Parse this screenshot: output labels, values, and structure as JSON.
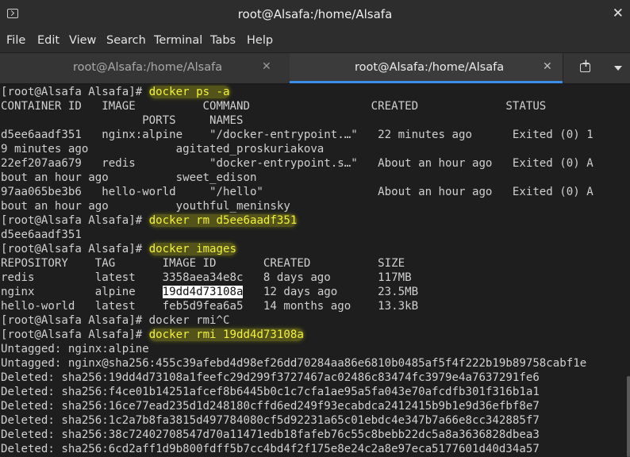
{
  "window": {
    "title": "root@Alsafa:/home/Alsafa",
    "close_glyph": "✕"
  },
  "menu": [
    "File",
    "Edit",
    "View",
    "Search",
    "Terminal",
    "Tabs",
    "Help"
  ],
  "tabs": [
    {
      "label": "root@Alsafa:/home/Alsafa",
      "active": false
    },
    {
      "label": "root@Alsafa:/home/Alsafa",
      "active": true
    }
  ],
  "tab_close_glyph": "✕",
  "icons": {
    "window": "terminal-icon",
    "new_tab": "new-tab-icon",
    "menu": "chevron-down-icon"
  },
  "colors": {
    "highlight": "#f2f23a",
    "tab_accent": "#3a8ee6",
    "terminal_bg": "#1e1e1e"
  },
  "lines": [
    {
      "prompt": "[root@Alsafa Alsafa]# ",
      "cmd": "docker ps -a"
    },
    {
      "text": "CONTAINER ID   IMAGE          COMMAND                  CREATED             STATUS"
    },
    {
      "text": "                     PORTS     NAMES"
    },
    {
      "text": "d5ee6aadf351   nginx:alpine    \"/docker-entrypoint.…\"   22 minutes ago      Exited (0) 1"
    },
    {
      "text": "9 minutes ago             agitated_proskuriakova"
    },
    {
      "text": "22ef207aa679   redis           \"docker-entrypoint.s…\"   About an hour ago   Exited (0) A"
    },
    {
      "text": "bout an hour ago          sweet_edison"
    },
    {
      "text": "97aa065be3b6   hello-world     \"/hello\"                 About an hour ago   Exited (0) A"
    },
    {
      "text": "bout an hour ago          youthful_meninsky"
    },
    {
      "prompt": "[root@Alsafa Alsafa]# ",
      "cmd": "docker rm d5ee6aadf351"
    },
    {
      "text": "d5ee6aadf351"
    },
    {
      "prompt": "[root@Alsafa Alsafa]# ",
      "cmd": "docker images"
    },
    {
      "text": "REPOSITORY    TAG       IMAGE ID       CREATED          SIZE"
    },
    {
      "text": "redis         latest    3358aea34e8c   8 days ago       117MB"
    },
    {
      "before": "nginx         alpine    ",
      "selected": "19dd4d73108a",
      "after": "   12 days ago      23.5MB"
    },
    {
      "text": "hello-world   latest    feb5d9fea6a5   14 months ago    13.3kB"
    },
    {
      "text": "[root@Alsafa Alsafa]# docker rmi^C"
    },
    {
      "prompt": "[root@Alsafa Alsafa]# ",
      "cmd": "docker rmi 19dd4d73108a"
    },
    {
      "text": "Untagged: nginx:alpine"
    },
    {
      "text": "Untagged: nginx@sha256:455c39afebd4d98ef26dd70284aa86e6810b0485af5f4f222b19b89758cabf1e"
    },
    {
      "text": "Deleted: sha256:19dd4d73108a1feefc29d299f3727467ac02486c83474fc3979e4a7637291fe6"
    },
    {
      "text": "Deleted: sha256:f4ce01b14251afcef8b6445b0c1c7cfa1ae95a5fa043e70afcdfb301f316b1a1"
    },
    {
      "text": "Deleted: sha256:16ce77ead235d1d248180cffd6ed249f93ecabdca2412415b9b1e9d36efbf8e7"
    },
    {
      "text": "Deleted: sha256:1c2a7b8fa3815d497784080cf5d92231a65c01ebdc4e347b7a66e8cc342885f7"
    },
    {
      "text": "Deleted: sha256:38c72402708547d70a11471edb18fafeb76c55c8bebb22dc5a8a3636828dbea3"
    },
    {
      "text": "Deleted: sha256:6cd2aff1d9b800fdff5b7cc4bd4f2f175e8e24c2a8e97eca5177601d40d34a57"
    }
  ]
}
